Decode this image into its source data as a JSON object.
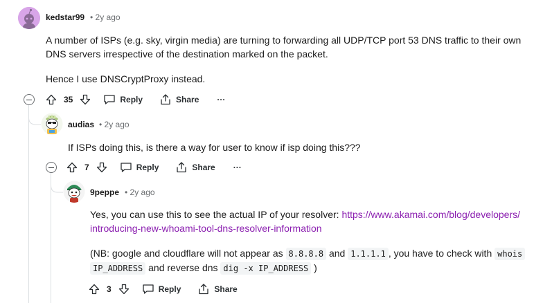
{
  "comments": [
    {
      "author": "kedstar99",
      "time": "• 2y ago",
      "paragraphs": [
        "A number of ISPs (e.g. sky, virgin media) are turning to forwarding all UDP/TCP port 53 DNS traffic to their own",
        "DNS servers irrespective of the destination marked on the packet.",
        "Hence I use DNSCryptProxy instead."
      ],
      "votes": "35"
    },
    {
      "author": "audias",
      "time": "• 2y ago",
      "paragraphs": [
        "If ISPs doing this, is there a way for user to know if isp doing this???"
      ],
      "votes": "7"
    },
    {
      "author": "9peppe",
      "time": "• 2y ago",
      "text_prefix": "Yes, you can use this to see the actual IP of your resolver: ",
      "link_line1": "https://www.akamai.com/blog/developers/",
      "link_line2": "introducing-new-whoami-tool-dns-resolver-information",
      "nb_1": "(NB: google and cloudflare will not appear as ",
      "code_1": "8.8.8.8",
      "nb_2": " and ",
      "code_2": "1.1.1.1",
      "nb_3": ", you have to check with ",
      "code_3": "whois",
      "code_4": "IP_ADDRESS",
      "nb_4": " and reverse dns ",
      "code_5": "dig -x IP_ADDRESS",
      "nb_5": " )",
      "votes": "3"
    }
  ],
  "actions": {
    "reply": "Reply",
    "share": "Share",
    "more": "···"
  },
  "icons": {
    "upvote": "upvote-icon",
    "downvote": "downvote-icon",
    "reply": "comment-bubble-icon",
    "share": "share-icon",
    "collapse": "collapse-icon"
  },
  "colors": {
    "link": "#8b1fb0",
    "avatar_bg_1": "#d8a5e8",
    "thread_line": "#dcdfe2"
  }
}
